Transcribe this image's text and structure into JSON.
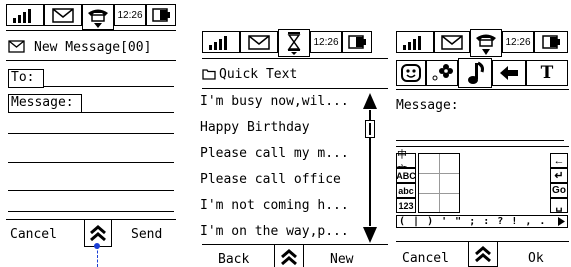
{
  "status": {
    "time": "12:26"
  },
  "screen1": {
    "title": "New Message[00]",
    "to_label": "To:",
    "message_label": "Message:",
    "left_button": "Cancel",
    "right_button": "Send"
  },
  "screen2": {
    "title": "Quick Text",
    "items": [
      "I'm busy now,wil...",
      "Happy Birthday",
      "Please call my m...",
      "Please call office",
      "I'm not coming h...",
      "I'm on the way,p..."
    ],
    "left_button": "Back",
    "right_button": "New"
  },
  "screen3": {
    "toolbar_t": "T",
    "message_label": "Message:",
    "input_modes": [
      "中文",
      "ABC",
      "abc",
      "123"
    ],
    "symbol_row": "( | ) ' \" ; : ? ! , .",
    "left_button": "Cancel",
    "right_button": "Ok",
    "side_keys": [
      "←",
      "↵",
      "Go",
      "␣"
    ]
  }
}
